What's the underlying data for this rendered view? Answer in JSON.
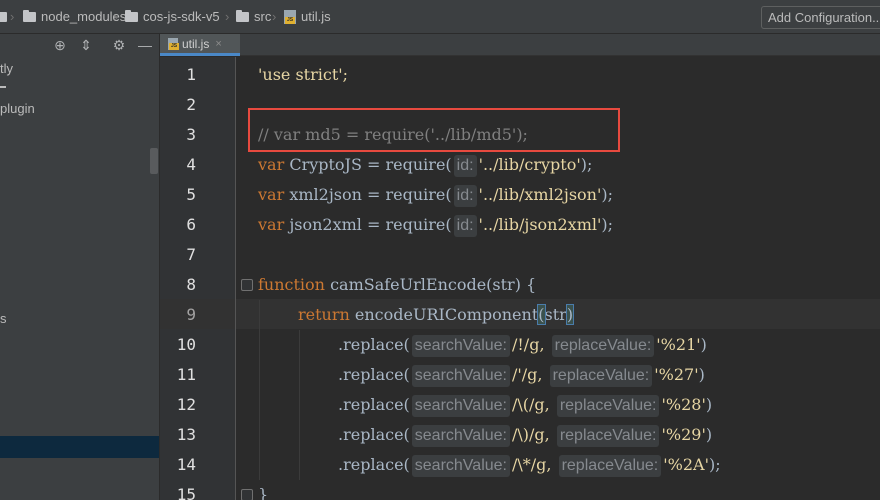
{
  "breadcrumb": {
    "items": [
      "node_modules",
      "cos-js-sdk-v5",
      "src",
      "util.js"
    ],
    "separator": "›"
  },
  "toolbar": {
    "add_configuration": "Add Configuration..."
  },
  "sidebar": {
    "visible_fragments": [
      "tly",
      "plugin",
      "s"
    ],
    "toolbar_icons": [
      "crosshair-icon",
      "collapse-icon",
      "gear-icon",
      "minimize-icon"
    ]
  },
  "editor": {
    "tab_label": "util.js",
    "tab_close": "×",
    "lines": [
      {
        "n": "1"
      },
      {
        "n": "2"
      },
      {
        "n": "3"
      },
      {
        "n": "4"
      },
      {
        "n": "5"
      },
      {
        "n": "6"
      },
      {
        "n": "7"
      },
      {
        "n": "8"
      },
      {
        "n": "9"
      },
      {
        "n": "10"
      },
      {
        "n": "11"
      },
      {
        "n": "12"
      },
      {
        "n": "13"
      },
      {
        "n": "14"
      },
      {
        "n": "15"
      }
    ],
    "code": {
      "l1": "'use strict';",
      "l3": "// var md5 = require('../lib/md5');",
      "l4": {
        "kw": "var",
        "name": " CryptoJS = require(",
        "hint": "id:",
        "str": "'../lib/crypto'",
        "end": ");"
      },
      "l5": {
        "kw": "var",
        "name": " xml2json = require(",
        "hint": "id:",
        "str": "'../lib/xml2json'",
        "end": ");"
      },
      "l6": {
        "kw": "var",
        "name": " json2xml = require(",
        "hint": "id:",
        "str": "'../lib/json2xml'",
        "end": ");"
      },
      "l8": {
        "kw": "function",
        "name": " camSafeUrlEncode(str) {"
      },
      "l9": {
        "kw": "return",
        "call": " encodeURIComponent",
        "open": "(",
        "arg": "str",
        "close": ")"
      },
      "l10": {
        "call": ".replace(",
        "hint1": "searchValue:",
        "regex": "/!/g,",
        "hint2": "replaceValue:",
        "str": "'%21'",
        "end": ")"
      },
      "l11": {
        "call": ".replace(",
        "hint1": "searchValue:",
        "regex": "/'/g,",
        "hint2": "replaceValue:",
        "str": "'%27'",
        "end": ")"
      },
      "l12": {
        "call": ".replace(",
        "hint1": "searchValue:",
        "regex": "/\\(/g,",
        "hint2": "replaceValue:",
        "str": "'%28'",
        "end": ")"
      },
      "l13": {
        "call": ".replace(",
        "hint1": "searchValue:",
        "regex": "/\\)/g,",
        "hint2": "replaceValue:",
        "str": "'%29'",
        "end": ")"
      },
      "l14": {
        "call": ".replace(",
        "hint1": "searchValue:",
        "regex": "/\\*/g,",
        "hint2": "replaceValue:",
        "str": "'%2A'",
        "end": ");"
      },
      "l15": "}"
    }
  },
  "colors": {
    "keyword": "#cc7832",
    "string": "#e7d6a4",
    "comment": "#808080",
    "highlight_box": "#e84a3f"
  }
}
